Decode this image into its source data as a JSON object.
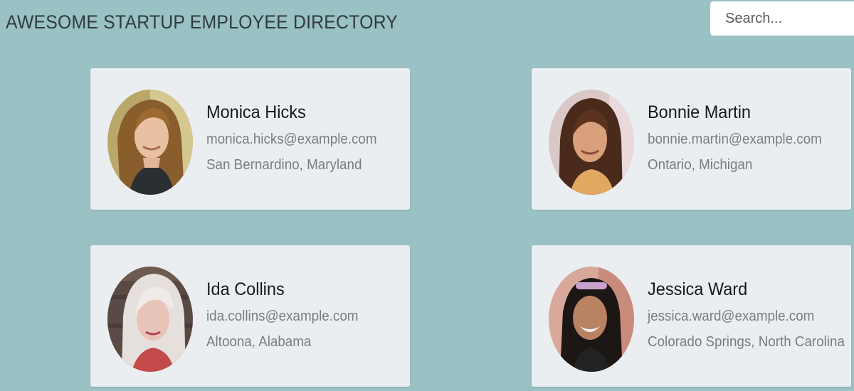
{
  "header": {
    "title": "AWESOME STARTUP EMPLOYEE DIRECTORY"
  },
  "search": {
    "placeholder": "Search..."
  },
  "employees": [
    {
      "name": "Monica Hicks",
      "email": "monica.hicks@example.com",
      "location": "San Bernardino, Maryland"
    },
    {
      "name": "Bonnie Martin",
      "email": "bonnie.martin@example.com",
      "location": "Ontario, Michigan"
    },
    {
      "name": "Ida Collins",
      "email": "ida.collins@example.com",
      "location": "Altoona, Alabama"
    },
    {
      "name": "Jessica Ward",
      "email": "jessica.ward@example.com",
      "location": "Colorado Springs, North Carolina"
    }
  ],
  "colors": {
    "background": "#9ac1c3",
    "card": "#ebeef0",
    "name_text": "#15191b",
    "detail_text": "#767e84"
  }
}
